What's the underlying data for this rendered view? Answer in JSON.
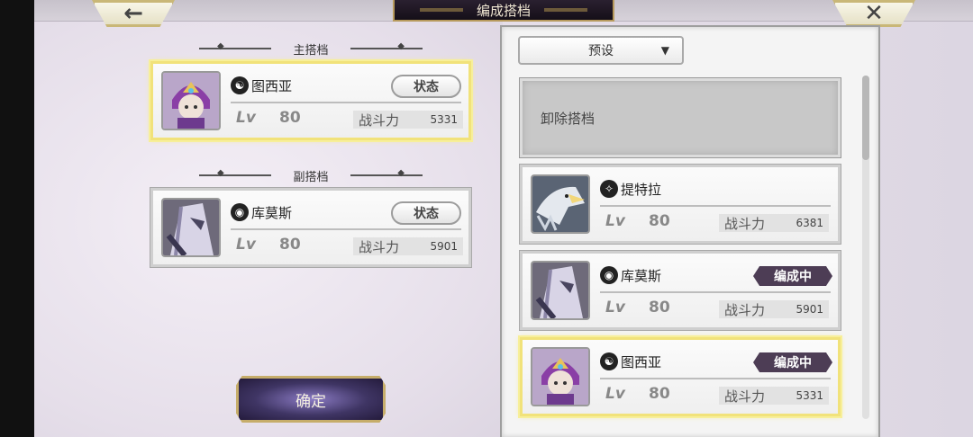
{
  "nav": {
    "back_icon": "←",
    "close_icon": "✕"
  },
  "title": "编成搭档",
  "main_slot": {
    "label": "主搭档",
    "name": "图西亚",
    "element_icon": "☯",
    "status_label": "状态",
    "lv_label": "Lv",
    "level": "80",
    "power_label": "战斗力",
    "power": "5331"
  },
  "sub_slot": {
    "label": "副搭档",
    "name": "库莫斯",
    "element_icon": "◉",
    "status_label": "状态",
    "lv_label": "Lv",
    "level": "80",
    "power_label": "战斗力",
    "power": "5901"
  },
  "confirm_label": "确定",
  "preset": {
    "label": "预设",
    "arrow": "▼"
  },
  "remove_label": "卸除搭档",
  "list": [
    {
      "name": "提特拉",
      "element_icon": "✧",
      "lv_label": "Lv",
      "level": "80",
      "power_label": "战斗力",
      "power": "6381",
      "badge": ""
    },
    {
      "name": "库莫斯",
      "element_icon": "◉",
      "lv_label": "Lv",
      "level": "80",
      "power_label": "战斗力",
      "power": "5901",
      "badge": "编成中"
    },
    {
      "name": "图西亚",
      "element_icon": "☯",
      "lv_label": "Lv",
      "level": "80",
      "power_label": "战斗力",
      "power": "5331",
      "badge": "编成中"
    }
  ]
}
